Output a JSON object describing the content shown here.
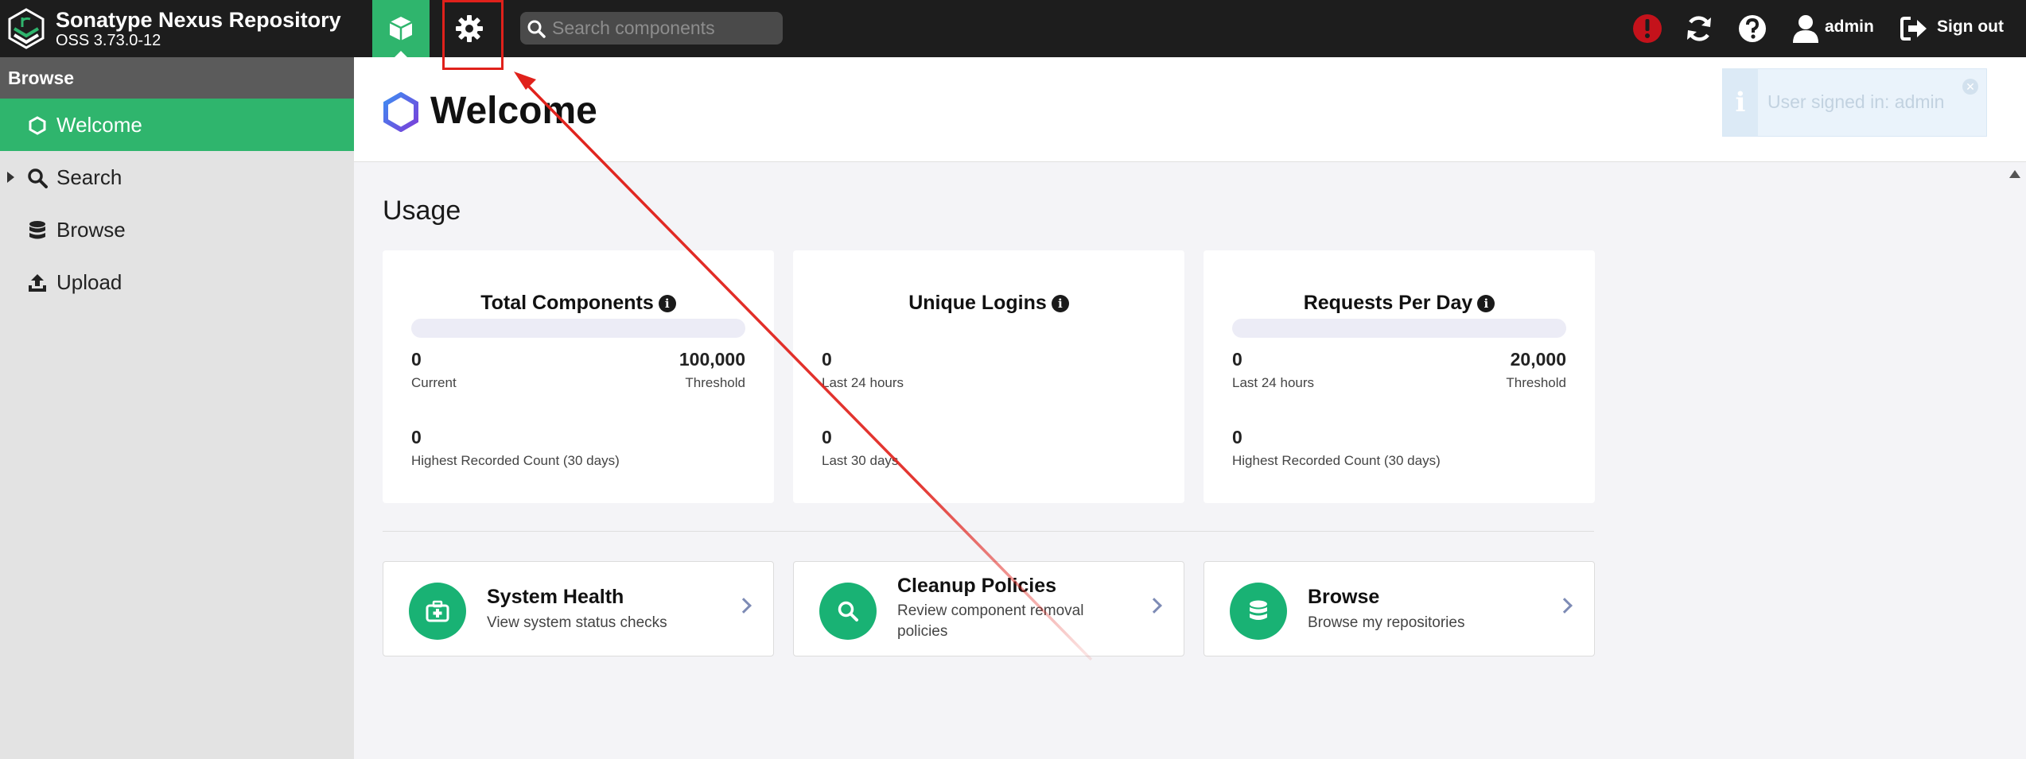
{
  "header": {
    "product_name": "Sonatype Nexus Repository",
    "version": "OSS 3.73.0-12",
    "search_placeholder": "Search components",
    "user_label": "admin",
    "signout_label": "Sign out"
  },
  "sidebar": {
    "header": "Browse",
    "items": [
      {
        "label": "Welcome",
        "icon": "hexagon-icon",
        "active": true
      },
      {
        "label": "Search",
        "icon": "search-icon",
        "active": false
      },
      {
        "label": "Browse",
        "icon": "database-icon",
        "active": false
      },
      {
        "label": "Upload",
        "icon": "upload-icon",
        "active": false
      }
    ]
  },
  "main": {
    "title": "Welcome",
    "notice": "User signed in: admin",
    "section_title": "Usage",
    "cards": [
      {
        "title": "Total Components",
        "fill": 0.0,
        "primary_value": "0",
        "primary_label": "Current",
        "threshold_value": "100,000",
        "threshold_label": "Threshold",
        "secondary_value": "0",
        "secondary_label": "Highest Recorded Count (30 days)"
      },
      {
        "title": "Unique Logins",
        "primary_value": "0",
        "primary_label": "Last 24 hours",
        "secondary_value": "0",
        "secondary_label": "Last 30 days"
      },
      {
        "title": "Requests Per Day",
        "fill": 0.0,
        "primary_value": "0",
        "primary_label": "Last 24 hours",
        "threshold_value": "20,000",
        "threshold_label": "Threshold",
        "secondary_value": "0",
        "secondary_label": "Highest Recorded Count (30 days)"
      }
    ],
    "links": [
      {
        "title": "System Health",
        "desc": "View system status checks",
        "icon": "medkit-icon"
      },
      {
        "title": "Cleanup Policies",
        "desc": "Review component removal policies",
        "icon": "search-icon"
      },
      {
        "title": "Browse",
        "desc": "Browse my repositories",
        "icon": "database-icon"
      }
    ]
  },
  "colors": {
    "accent_green": "#2fb56d",
    "topbar": "#1d1d1d",
    "alert_red": "#c4121b",
    "annotation_red": "#e0211b"
  }
}
